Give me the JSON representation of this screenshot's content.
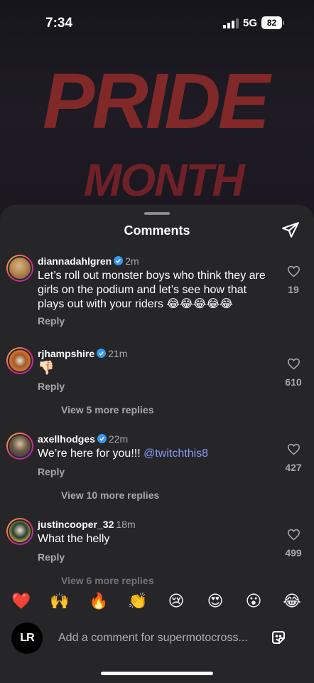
{
  "status_bar": {
    "time": "7:34",
    "network": "5G",
    "battery": "82"
  },
  "post": {
    "art_text": [
      "PRIDE",
      "MONTH"
    ]
  },
  "sheet": {
    "title": "Comments"
  },
  "comments": [
    {
      "username": "diannadahlgren",
      "time": "2m",
      "text": "Let’s roll out monster boys who think they are girls on the podium and let’s see how that plays out with your riders 😂😂😂😂😂",
      "reply": "Reply",
      "likes": "19"
    },
    {
      "username": "rjhampshire",
      "time": "21m",
      "text": "👎🏻",
      "reply": "Reply",
      "likes": "610",
      "more_replies": "View 5 more replies"
    },
    {
      "username": "axellhodges",
      "time": "22m",
      "text": "We’re here for you!!! ",
      "mention": "@twitchthis8",
      "reply": "Reply",
      "likes": "427",
      "more_replies": "View 10 more replies"
    },
    {
      "username": "justincooper_32",
      "time": "18m",
      "text": "What the helly",
      "reply": "Reply",
      "likes": "499",
      "more_replies": "View 6 more replies"
    }
  ],
  "quick_reactions": [
    "❤️",
    "🙌",
    "🔥",
    "👏",
    "😢",
    "😍",
    "😮",
    "😂"
  ],
  "composer": {
    "avatar_text": "LR",
    "placeholder": "Add a comment for supermotocross..."
  },
  "colors": {
    "sheet_bg": "#262628",
    "verified": "#3797f0",
    "mention": "#8a9bf5",
    "muted": "#a8a8a8"
  }
}
